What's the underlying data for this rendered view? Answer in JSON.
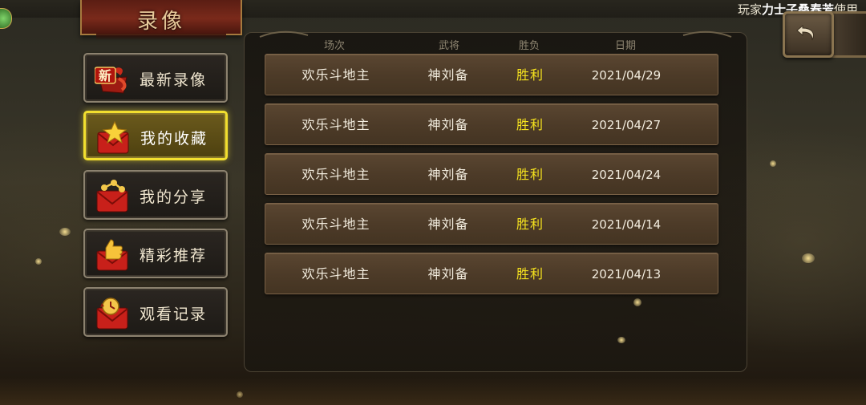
{
  "header": {
    "title": "录像",
    "player_prefix": "玩家",
    "player_name": "力士子桑春芳",
    "player_suffix": "使用"
  },
  "menu": {
    "items": [
      {
        "label": "最新录像",
        "icon": "new-ribbon-icon",
        "active": false
      },
      {
        "label": "我的收藏",
        "icon": "star-envelope-icon",
        "active": true
      },
      {
        "label": "我的分享",
        "icon": "share-envelope-icon",
        "active": false
      },
      {
        "label": "精彩推荐",
        "icon": "thumbs-up-envelope-icon",
        "active": false
      },
      {
        "label": "观看记录",
        "icon": "history-envelope-icon",
        "active": false
      }
    ]
  },
  "table": {
    "headers": [
      "场次",
      "武将",
      "胜负",
      "日期"
    ],
    "rows": [
      {
        "mode": "欢乐斗地主",
        "general": "神刘备",
        "result": "胜利",
        "date": "2021/04/29"
      },
      {
        "mode": "欢乐斗地主",
        "general": "神刘备",
        "result": "胜利",
        "date": "2021/04/27"
      },
      {
        "mode": "欢乐斗地主",
        "general": "神刘备",
        "result": "胜利",
        "date": "2021/04/24"
      },
      {
        "mode": "欢乐斗地主",
        "general": "神刘备",
        "result": "胜利",
        "date": "2021/04/14"
      },
      {
        "mode": "欢乐斗地主",
        "general": "神刘备",
        "result": "胜利",
        "date": "2021/04/13"
      }
    ]
  },
  "new_badge_text": "新",
  "colors": {
    "win": "#f5e21e",
    "active_border": "#f2df2f",
    "title": "#e6c99a"
  }
}
